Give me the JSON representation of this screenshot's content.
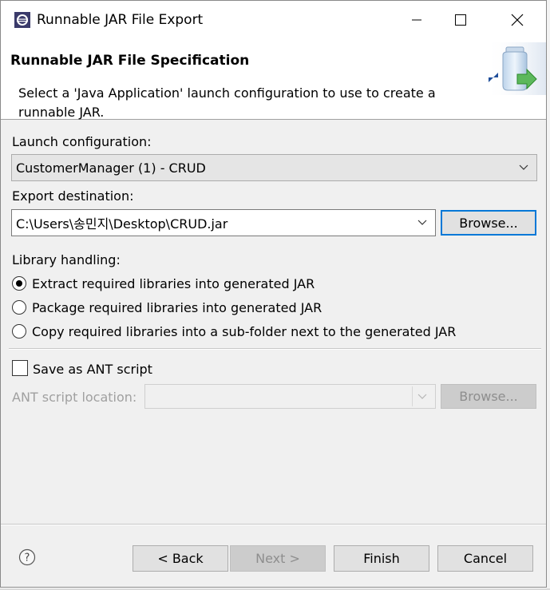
{
  "window": {
    "title": "Runnable JAR File Export",
    "minimize_icon": "minimize-icon",
    "maximize_icon": "maximize-icon",
    "close_icon": "close-icon"
  },
  "banner": {
    "title": "Runnable JAR File Specification",
    "description": "Select a 'Java Application' launch configuration to use to create a runnable JAR.",
    "graphic_icon": "jar-export-icon"
  },
  "launch": {
    "label": "Launch configuration:",
    "value": "CustomerManager (1) - CRUD"
  },
  "export": {
    "label": "Export destination:",
    "value": "C:\\Users\\송민지\\Desktop\\CRUD.jar",
    "browse_label": "Browse..."
  },
  "library": {
    "label": "Library handling:",
    "options": [
      {
        "label": "Extract required libraries into generated JAR",
        "checked": true
      },
      {
        "label": "Package required libraries into generated JAR",
        "checked": false
      },
      {
        "label": "Copy required libraries into a sub-folder next to the generated JAR",
        "checked": false
      }
    ]
  },
  "ant": {
    "checkbox_label": "Save as ANT script",
    "checked": false,
    "location_label": "ANT script location:",
    "location_value": "",
    "browse_label": "Browse..."
  },
  "footer": {
    "help_icon": "help-icon",
    "back_label": "< Back",
    "next_label": "Next >",
    "finish_label": "Finish",
    "cancel_label": "Cancel"
  },
  "colors": {
    "dialog_bg": "#f0f0f0",
    "focus_border": "#0078d7",
    "disabled_text": "#8e8e8e"
  }
}
